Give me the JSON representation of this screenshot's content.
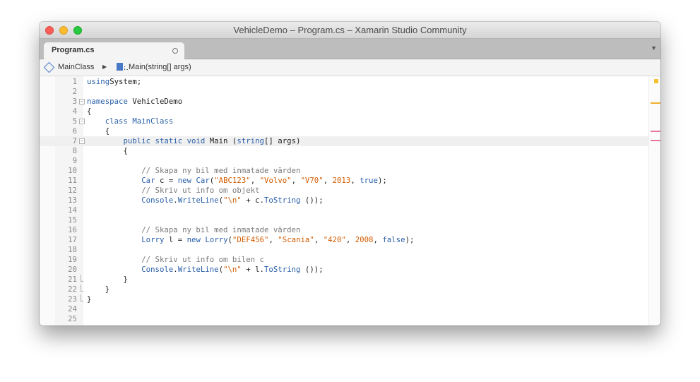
{
  "window": {
    "title": "VehicleDemo – Program.cs – Xamarin Studio Community"
  },
  "tabs": [
    {
      "label": "Program.cs",
      "active": true
    }
  ],
  "breadcrumb": {
    "class_label": "MainClass",
    "method_label": "Main(string[] args)"
  },
  "editor": {
    "current_line": 7,
    "lines": [
      {
        "n": "1",
        "fold": "",
        "code": [
          [
            "kw",
            "using"
          ],
          [
            "",
            "System;"
          ]
        ]
      },
      {
        "n": "2",
        "fold": "",
        "code": []
      },
      {
        "n": "3",
        "fold": "start",
        "code": [
          [
            "kw",
            "namespace"
          ],
          [
            "",
            " VehicleDemo"
          ]
        ]
      },
      {
        "n": "4",
        "fold": "",
        "code": [
          [
            "",
            "{"
          ]
        ]
      },
      {
        "n": "5",
        "fold": "start",
        "code": [
          [
            "",
            "    "
          ],
          [
            "kw",
            "class"
          ],
          [
            "",
            " "
          ],
          [
            "ty",
            "MainClass"
          ]
        ]
      },
      {
        "n": "6",
        "fold": "",
        "code": [
          [
            "",
            "    {"
          ]
        ]
      },
      {
        "n": "7",
        "fold": "start",
        "code": [
          [
            "",
            "        "
          ],
          [
            "kw",
            "public static void"
          ],
          [
            "",
            " Main ("
          ],
          [
            "kw",
            "string"
          ],
          [
            "",
            "[] args)"
          ]
        ]
      },
      {
        "n": "8",
        "fold": "",
        "code": [
          [
            "",
            "        {"
          ]
        ]
      },
      {
        "n": "9",
        "fold": "",
        "code": []
      },
      {
        "n": "10",
        "fold": "",
        "code": [
          [
            "",
            "            "
          ],
          [
            "cm",
            "// Skapa ny bil med inmatade värden"
          ]
        ]
      },
      {
        "n": "11",
        "fold": "",
        "code": [
          [
            "",
            "            "
          ],
          [
            "ty",
            "Car"
          ],
          [
            "",
            " c = "
          ],
          [
            "kw",
            "new"
          ],
          [
            "",
            " "
          ],
          [
            "ty",
            "Car"
          ],
          [
            "",
            "("
          ],
          [
            "st",
            "\"ABC123\""
          ],
          [
            "",
            ", "
          ],
          [
            "st",
            "\"Volvo\""
          ],
          [
            "",
            ", "
          ],
          [
            "st",
            "\"V70\""
          ],
          [
            "",
            ", "
          ],
          [
            "nu",
            "2013"
          ],
          [
            "",
            ", "
          ],
          [
            "kw",
            "true"
          ],
          [
            "",
            ");"
          ]
        ]
      },
      {
        "n": "12",
        "fold": "",
        "code": [
          [
            "",
            "            "
          ],
          [
            "cm",
            "// Skriv ut info om objekt"
          ]
        ]
      },
      {
        "n": "13",
        "fold": "",
        "code": [
          [
            "",
            "            "
          ],
          [
            "ty",
            "Console"
          ],
          [
            "",
            "."
          ],
          [
            "ty",
            "WriteLine"
          ],
          [
            "",
            "("
          ],
          [
            "st",
            "\"\\n\""
          ],
          [
            "",
            " + c."
          ],
          [
            "ty",
            "ToString"
          ],
          [
            "",
            " ());"
          ]
        ]
      },
      {
        "n": "14",
        "fold": "",
        "code": []
      },
      {
        "n": "15",
        "fold": "",
        "code": []
      },
      {
        "n": "16",
        "fold": "",
        "code": [
          [
            "",
            "            "
          ],
          [
            "cm",
            "// Skapa ny bil med inmatade värden"
          ]
        ]
      },
      {
        "n": "17",
        "fold": "",
        "code": [
          [
            "",
            "            "
          ],
          [
            "ty",
            "Lorry"
          ],
          [
            "",
            " l = "
          ],
          [
            "kw",
            "new"
          ],
          [
            "",
            " "
          ],
          [
            "ty",
            "Lorry"
          ],
          [
            "",
            "("
          ],
          [
            "st",
            "\"DEF456\""
          ],
          [
            "",
            ", "
          ],
          [
            "st",
            "\"Scania\""
          ],
          [
            "",
            ", "
          ],
          [
            "st",
            "\"420\""
          ],
          [
            "",
            ", "
          ],
          [
            "nu",
            "2008"
          ],
          [
            "",
            ", "
          ],
          [
            "kw",
            "false"
          ],
          [
            "",
            ");"
          ]
        ]
      },
      {
        "n": "18",
        "fold": "",
        "code": []
      },
      {
        "n": "19",
        "fold": "",
        "code": [
          [
            "",
            "            "
          ],
          [
            "cm",
            "// Skriv ut info om bilen c"
          ]
        ]
      },
      {
        "n": "20",
        "fold": "",
        "code": [
          [
            "",
            "            "
          ],
          [
            "ty",
            "Console"
          ],
          [
            "",
            "."
          ],
          [
            "ty",
            "WriteLine"
          ],
          [
            "",
            "("
          ],
          [
            "st",
            "\"\\n\""
          ],
          [
            "",
            " + l."
          ],
          [
            "ty",
            "ToString"
          ],
          [
            "",
            " ());"
          ]
        ]
      },
      {
        "n": "21",
        "fold": "end",
        "code": [
          [
            "",
            "        }"
          ]
        ]
      },
      {
        "n": "22",
        "fold": "end",
        "code": [
          [
            "",
            "    }"
          ]
        ]
      },
      {
        "n": "23",
        "fold": "end",
        "code": [
          [
            "",
            "}"
          ]
        ]
      },
      {
        "n": "24",
        "fold": "",
        "code": []
      },
      {
        "n": "25",
        "fold": "",
        "code": []
      }
    ]
  },
  "scrollbar_markers": [
    {
      "kind": "warning",
      "color": "#f0b030"
    },
    {
      "kind": "error",
      "color": "#e8789a"
    },
    {
      "kind": "error",
      "color": "#e8789a"
    }
  ]
}
